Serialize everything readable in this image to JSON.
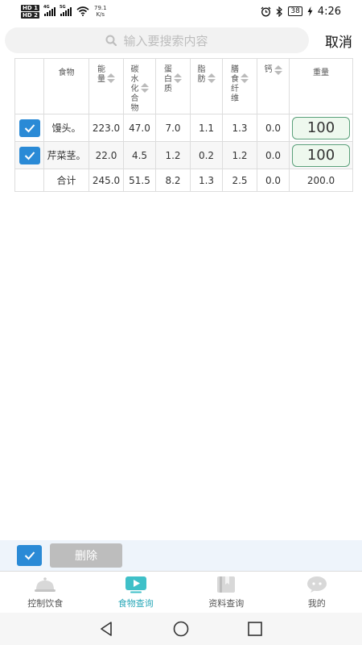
{
  "status_bar": {
    "hd1": "HD 1",
    "hd2": "HD 2",
    "net1": "4G",
    "net2": "5G",
    "speed_value": "79.1",
    "speed_unit": "K/s",
    "battery": "38",
    "time": "4:26"
  },
  "search": {
    "placeholder": "输入要搜索内容",
    "cancel_label": "取消"
  },
  "table": {
    "headers": [
      "食物",
      "能量",
      "碳水化合物",
      "蛋白质",
      "脂肪",
      "膳食纤维",
      "钙",
      "重量"
    ],
    "rows": [
      {
        "name": "馒头。",
        "energy": "223.0",
        "carbs": "47.0",
        "protein": "7.0",
        "fat": "1.1",
        "fiber": "1.3",
        "calcium": "0.0",
        "weight": "100"
      },
      {
        "name": "芹菜茎。",
        "energy": "22.0",
        "carbs": "4.5",
        "protein": "1.2",
        "fat": "0.2",
        "fiber": "1.2",
        "calcium": "0.0",
        "weight": "100"
      }
    ],
    "total": {
      "label": "合计",
      "energy": "245.0",
      "carbs": "51.5",
      "protein": "8.2",
      "fat": "1.3",
      "fiber": "2.5",
      "calcium": "0.0",
      "weight": "200.0"
    }
  },
  "actions": {
    "delete_label": "删除"
  },
  "tabs": [
    {
      "label": "控制饮食",
      "icon": "cloche-icon"
    },
    {
      "label": "食物查询",
      "icon": "video-icon"
    },
    {
      "label": "资料查询",
      "icon": "book-icon"
    },
    {
      "label": "我的",
      "icon": "chat-icon"
    }
  ],
  "colors": {
    "accent": "#2a8ad6",
    "tab_active": "#2aa8b8",
    "weight_border": "#5aa07a"
  }
}
